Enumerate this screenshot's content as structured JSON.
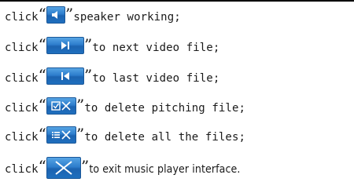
{
  "lines": [
    {
      "pre": "click ",
      "open": "“",
      "close": "”",
      "post": " speaker working;",
      "icon": "speaker-icon"
    },
    {
      "pre": "click ",
      "open": "“",
      "close": "”",
      "post": " to next video file;",
      "icon": "next-track-icon"
    },
    {
      "pre": "click ",
      "open": "“",
      "close": "”",
      "post": " to last video file;",
      "icon": "previous-track-icon"
    },
    {
      "pre": "click ",
      "open": "“",
      "close": "”",
      "post": " to delete pitching file;",
      "icon": "delete-selected-icon"
    },
    {
      "pre": "click ",
      "open": "“",
      "close": "”",
      "post": " to delete all the files;",
      "icon": "delete-all-icon"
    },
    {
      "pre": "click ",
      "open": "“",
      "close": "”",
      "post": " to exit music player interface.",
      "icon": "exit-icon"
    }
  ],
  "colors": {
    "button_blue": "#2d7dcc",
    "text": "#1a1a1a"
  }
}
